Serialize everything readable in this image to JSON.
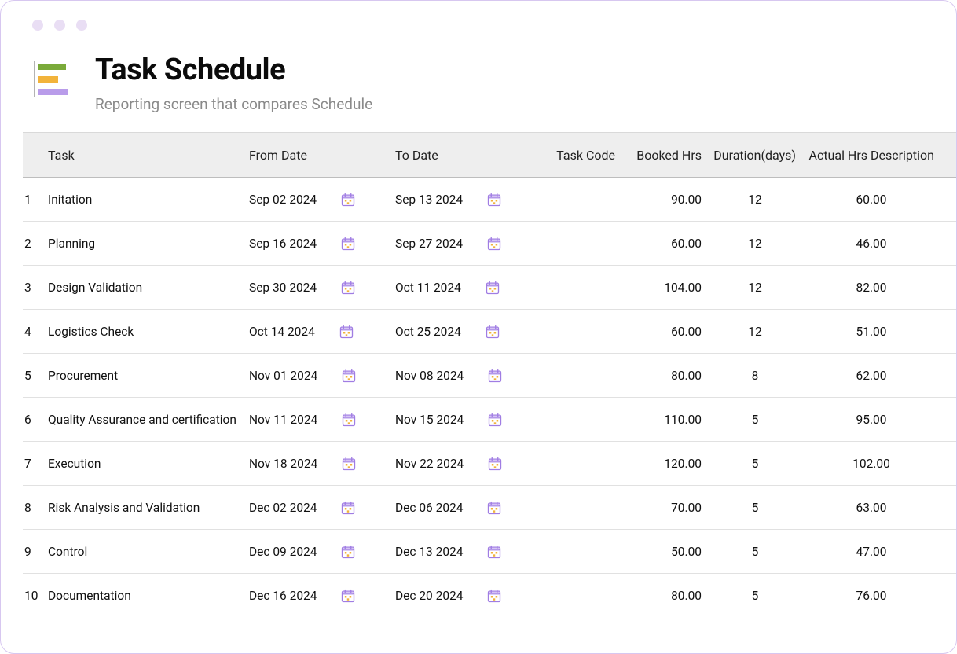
{
  "header": {
    "title": "Task Schedule",
    "subtitle": "Reporting screen that compares Schedule"
  },
  "columns": {
    "task": "Task",
    "from": "From Date",
    "to": "To Date",
    "code": "Task Code",
    "booked": "Booked Hrs",
    "duration": "Duration(days)",
    "actual": "Actual Hrs Description"
  },
  "rows": [
    {
      "idx": "1",
      "task": "Initation",
      "from": "Sep 02 2024",
      "to": "Sep 13 2024",
      "code": "",
      "booked": "90.00",
      "duration": "12",
      "actual": "60.00"
    },
    {
      "idx": "2",
      "task": "Planning",
      "from": "Sep 16 2024",
      "to": "Sep 27 2024",
      "code": "",
      "booked": "60.00",
      "duration": "12",
      "actual": "46.00"
    },
    {
      "idx": "3",
      "task": "Design Validation",
      "from": "Sep 30 2024",
      "to": "Oct 11 2024",
      "code": "",
      "booked": "104.00",
      "duration": "12",
      "actual": "82.00"
    },
    {
      "idx": "4",
      "task": "Logistics Check",
      "from": "Oct 14 2024",
      "to": "Oct 25 2024",
      "code": "",
      "booked": "60.00",
      "duration": "12",
      "actual": "51.00"
    },
    {
      "idx": "5",
      "task": "Procurement",
      "from": "Nov 01 2024",
      "to": "Nov 08 2024",
      "code": "",
      "booked": "80.00",
      "duration": "8",
      "actual": "62.00"
    },
    {
      "idx": "6",
      "task": "Quality Assurance and certification",
      "from": "Nov 11 2024",
      "to": "Nov 15 2024",
      "code": "",
      "booked": "110.00",
      "duration": "5",
      "actual": "95.00"
    },
    {
      "idx": "7",
      "task": "Execution",
      "from": "Nov 18 2024",
      "to": "Nov 22 2024",
      "code": "",
      "booked": "120.00",
      "duration": "5",
      "actual": "102.00"
    },
    {
      "idx": "8",
      "task": "Risk Analysis and Validation",
      "from": "Dec 02 2024",
      "to": "Dec 06 2024",
      "code": "",
      "booked": "70.00",
      "duration": "5",
      "actual": "63.00"
    },
    {
      "idx": "9",
      "task": "Control",
      "from": "Dec 09 2024",
      "to": "Dec 13 2024",
      "code": "",
      "booked": "50.00",
      "duration": "5",
      "actual": "47.00"
    },
    {
      "idx": "10",
      "task": "Documentation",
      "from": "Dec 16 2024",
      "to": "Dec 20 2024",
      "code": "",
      "booked": "80.00",
      "duration": "5",
      "actual": "76.00"
    }
  ]
}
